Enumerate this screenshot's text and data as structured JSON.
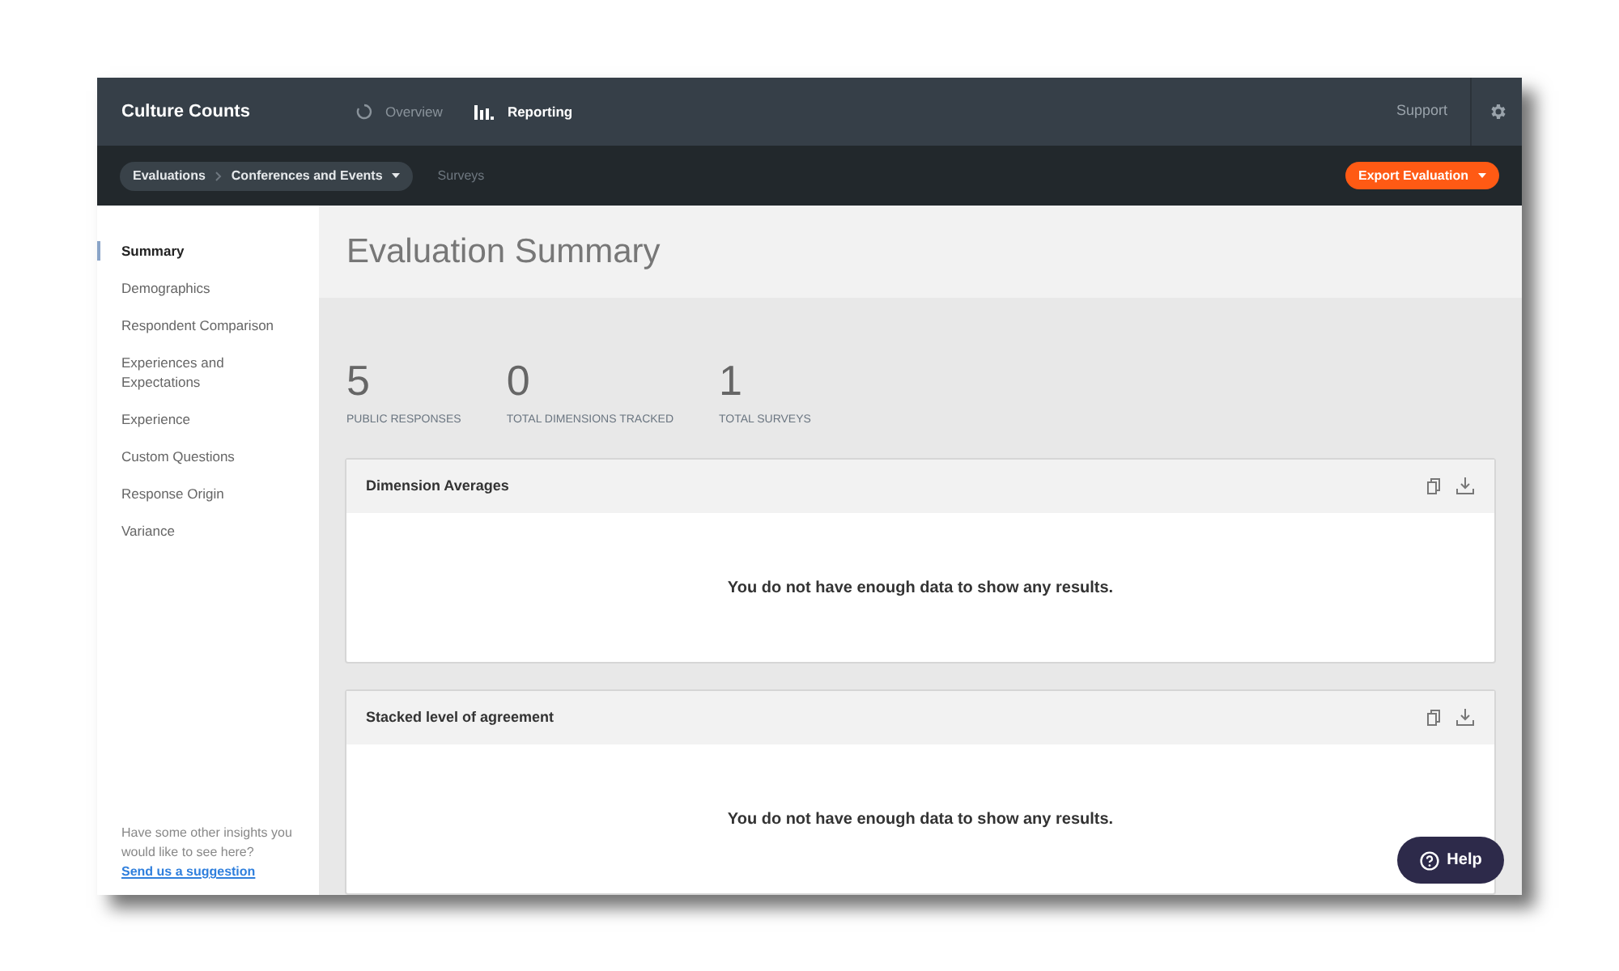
{
  "app": {
    "title": "Culture Counts"
  },
  "nav": [
    {
      "label": "Overview",
      "kind": "spinner",
      "selected": false
    },
    {
      "label": "Reporting",
      "kind": "bars",
      "selected": true
    }
  ],
  "support": "Support",
  "breadcrumb": [
    "Evaluations",
    "Conferences and Events"
  ],
  "surveys_link": "Surveys",
  "export_button": "Export Evaluation",
  "sidebar": {
    "items": [
      {
        "label": "Summary",
        "selected": true
      },
      {
        "label": "Demographics",
        "selected": false
      },
      {
        "label": "Respondent Comparison",
        "selected": false
      },
      {
        "label": "Experiences and Expectations",
        "selected": false
      },
      {
        "label": "Experience",
        "selected": false
      },
      {
        "label": "Custom Questions",
        "selected": false
      },
      {
        "label": "Response Origin",
        "selected": false
      },
      {
        "label": "Variance",
        "selected": false
      }
    ],
    "footer_text": "Have some other insights you would like to see here?",
    "footer_link": "Send us a suggestion"
  },
  "page_title": "Evaluation Summary",
  "stats": [
    {
      "value": "5",
      "label": "PUBLIC RESPONSES"
    },
    {
      "value": "0",
      "label": "TOTAL DIMENSIONS TRACKED"
    },
    {
      "value": "1",
      "label": "TOTAL SURVEYS"
    }
  ],
  "cards": [
    {
      "title": "Dimension Averages",
      "message": "You do not have enough data to show any results."
    },
    {
      "title": "Stacked level of agreement",
      "message": "You do not have enough data to show any results."
    }
  ],
  "help_button": "Help"
}
